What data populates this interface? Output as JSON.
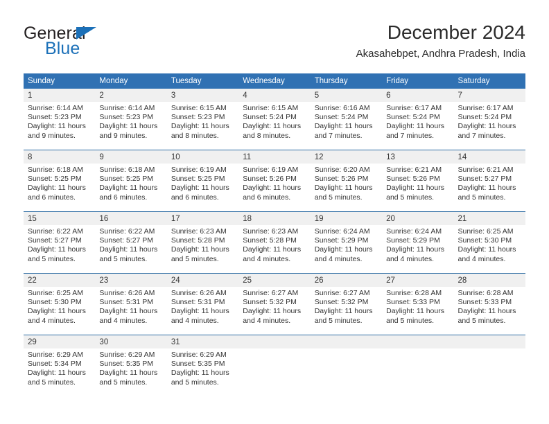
{
  "brand": {
    "name_part1": "General",
    "name_part2": "Blue",
    "color_dark": "#231f20",
    "color_blue": "#1b70b8"
  },
  "header": {
    "title": "December 2024",
    "subtitle": "Akasahebpet, Andhra Pradesh, India"
  },
  "theme": {
    "header_blue": "#3071b3",
    "rule_blue": "#2e6da4",
    "daynum_band": "#f0f0f0",
    "text": "#333333"
  },
  "calendar": {
    "weekday_headers": [
      "Sunday",
      "Monday",
      "Tuesday",
      "Wednesday",
      "Thursday",
      "Friday",
      "Saturday"
    ],
    "weeks": [
      [
        {
          "day": "1",
          "sunrise": "Sunrise: 6:14 AM",
          "sunset": "Sunset: 5:23 PM",
          "daylight_1": "Daylight: 11 hours",
          "daylight_2": "and 9 minutes."
        },
        {
          "day": "2",
          "sunrise": "Sunrise: 6:14 AM",
          "sunset": "Sunset: 5:23 PM",
          "daylight_1": "Daylight: 11 hours",
          "daylight_2": "and 9 minutes."
        },
        {
          "day": "3",
          "sunrise": "Sunrise: 6:15 AM",
          "sunset": "Sunset: 5:23 PM",
          "daylight_1": "Daylight: 11 hours",
          "daylight_2": "and 8 minutes."
        },
        {
          "day": "4",
          "sunrise": "Sunrise: 6:15 AM",
          "sunset": "Sunset: 5:24 PM",
          "daylight_1": "Daylight: 11 hours",
          "daylight_2": "and 8 minutes."
        },
        {
          "day": "5",
          "sunrise": "Sunrise: 6:16 AM",
          "sunset": "Sunset: 5:24 PM",
          "daylight_1": "Daylight: 11 hours",
          "daylight_2": "and 7 minutes."
        },
        {
          "day": "6",
          "sunrise": "Sunrise: 6:17 AM",
          "sunset": "Sunset: 5:24 PM",
          "daylight_1": "Daylight: 11 hours",
          "daylight_2": "and 7 minutes."
        },
        {
          "day": "7",
          "sunrise": "Sunrise: 6:17 AM",
          "sunset": "Sunset: 5:24 PM",
          "daylight_1": "Daylight: 11 hours",
          "daylight_2": "and 7 minutes."
        }
      ],
      [
        {
          "day": "8",
          "sunrise": "Sunrise: 6:18 AM",
          "sunset": "Sunset: 5:25 PM",
          "daylight_1": "Daylight: 11 hours",
          "daylight_2": "and 6 minutes."
        },
        {
          "day": "9",
          "sunrise": "Sunrise: 6:18 AM",
          "sunset": "Sunset: 5:25 PM",
          "daylight_1": "Daylight: 11 hours",
          "daylight_2": "and 6 minutes."
        },
        {
          "day": "10",
          "sunrise": "Sunrise: 6:19 AM",
          "sunset": "Sunset: 5:25 PM",
          "daylight_1": "Daylight: 11 hours",
          "daylight_2": "and 6 minutes."
        },
        {
          "day": "11",
          "sunrise": "Sunrise: 6:19 AM",
          "sunset": "Sunset: 5:26 PM",
          "daylight_1": "Daylight: 11 hours",
          "daylight_2": "and 6 minutes."
        },
        {
          "day": "12",
          "sunrise": "Sunrise: 6:20 AM",
          "sunset": "Sunset: 5:26 PM",
          "daylight_1": "Daylight: 11 hours",
          "daylight_2": "and 5 minutes."
        },
        {
          "day": "13",
          "sunrise": "Sunrise: 6:21 AM",
          "sunset": "Sunset: 5:26 PM",
          "daylight_1": "Daylight: 11 hours",
          "daylight_2": "and 5 minutes."
        },
        {
          "day": "14",
          "sunrise": "Sunrise: 6:21 AM",
          "sunset": "Sunset: 5:27 PM",
          "daylight_1": "Daylight: 11 hours",
          "daylight_2": "and 5 minutes."
        }
      ],
      [
        {
          "day": "15",
          "sunrise": "Sunrise: 6:22 AM",
          "sunset": "Sunset: 5:27 PM",
          "daylight_1": "Daylight: 11 hours",
          "daylight_2": "and 5 minutes."
        },
        {
          "day": "16",
          "sunrise": "Sunrise: 6:22 AM",
          "sunset": "Sunset: 5:27 PM",
          "daylight_1": "Daylight: 11 hours",
          "daylight_2": "and 5 minutes."
        },
        {
          "day": "17",
          "sunrise": "Sunrise: 6:23 AM",
          "sunset": "Sunset: 5:28 PM",
          "daylight_1": "Daylight: 11 hours",
          "daylight_2": "and 5 minutes."
        },
        {
          "day": "18",
          "sunrise": "Sunrise: 6:23 AM",
          "sunset": "Sunset: 5:28 PM",
          "daylight_1": "Daylight: 11 hours",
          "daylight_2": "and 4 minutes."
        },
        {
          "day": "19",
          "sunrise": "Sunrise: 6:24 AM",
          "sunset": "Sunset: 5:29 PM",
          "daylight_1": "Daylight: 11 hours",
          "daylight_2": "and 4 minutes."
        },
        {
          "day": "20",
          "sunrise": "Sunrise: 6:24 AM",
          "sunset": "Sunset: 5:29 PM",
          "daylight_1": "Daylight: 11 hours",
          "daylight_2": "and 4 minutes."
        },
        {
          "day": "21",
          "sunrise": "Sunrise: 6:25 AM",
          "sunset": "Sunset: 5:30 PM",
          "daylight_1": "Daylight: 11 hours",
          "daylight_2": "and 4 minutes."
        }
      ],
      [
        {
          "day": "22",
          "sunrise": "Sunrise: 6:25 AM",
          "sunset": "Sunset: 5:30 PM",
          "daylight_1": "Daylight: 11 hours",
          "daylight_2": "and 4 minutes."
        },
        {
          "day": "23",
          "sunrise": "Sunrise: 6:26 AM",
          "sunset": "Sunset: 5:31 PM",
          "daylight_1": "Daylight: 11 hours",
          "daylight_2": "and 4 minutes."
        },
        {
          "day": "24",
          "sunrise": "Sunrise: 6:26 AM",
          "sunset": "Sunset: 5:31 PM",
          "daylight_1": "Daylight: 11 hours",
          "daylight_2": "and 4 minutes."
        },
        {
          "day": "25",
          "sunrise": "Sunrise: 6:27 AM",
          "sunset": "Sunset: 5:32 PM",
          "daylight_1": "Daylight: 11 hours",
          "daylight_2": "and 4 minutes."
        },
        {
          "day": "26",
          "sunrise": "Sunrise: 6:27 AM",
          "sunset": "Sunset: 5:32 PM",
          "daylight_1": "Daylight: 11 hours",
          "daylight_2": "and 5 minutes."
        },
        {
          "day": "27",
          "sunrise": "Sunrise: 6:28 AM",
          "sunset": "Sunset: 5:33 PM",
          "daylight_1": "Daylight: 11 hours",
          "daylight_2": "and 5 minutes."
        },
        {
          "day": "28",
          "sunrise": "Sunrise: 6:28 AM",
          "sunset": "Sunset: 5:33 PM",
          "daylight_1": "Daylight: 11 hours",
          "daylight_2": "and 5 minutes."
        }
      ],
      [
        {
          "day": "29",
          "sunrise": "Sunrise: 6:29 AM",
          "sunset": "Sunset: 5:34 PM",
          "daylight_1": "Daylight: 11 hours",
          "daylight_2": "and 5 minutes."
        },
        {
          "day": "30",
          "sunrise": "Sunrise: 6:29 AM",
          "sunset": "Sunset: 5:35 PM",
          "daylight_1": "Daylight: 11 hours",
          "daylight_2": "and 5 minutes."
        },
        {
          "day": "31",
          "sunrise": "Sunrise: 6:29 AM",
          "sunset": "Sunset: 5:35 PM",
          "daylight_1": "Daylight: 11 hours",
          "daylight_2": "and 5 minutes."
        },
        {
          "day": "",
          "sunrise": "",
          "sunset": "",
          "daylight_1": "",
          "daylight_2": ""
        },
        {
          "day": "",
          "sunrise": "",
          "sunset": "",
          "daylight_1": "",
          "daylight_2": ""
        },
        {
          "day": "",
          "sunrise": "",
          "sunset": "",
          "daylight_1": "",
          "daylight_2": ""
        },
        {
          "day": "",
          "sunrise": "",
          "sunset": "",
          "daylight_1": "",
          "daylight_2": ""
        }
      ]
    ]
  }
}
